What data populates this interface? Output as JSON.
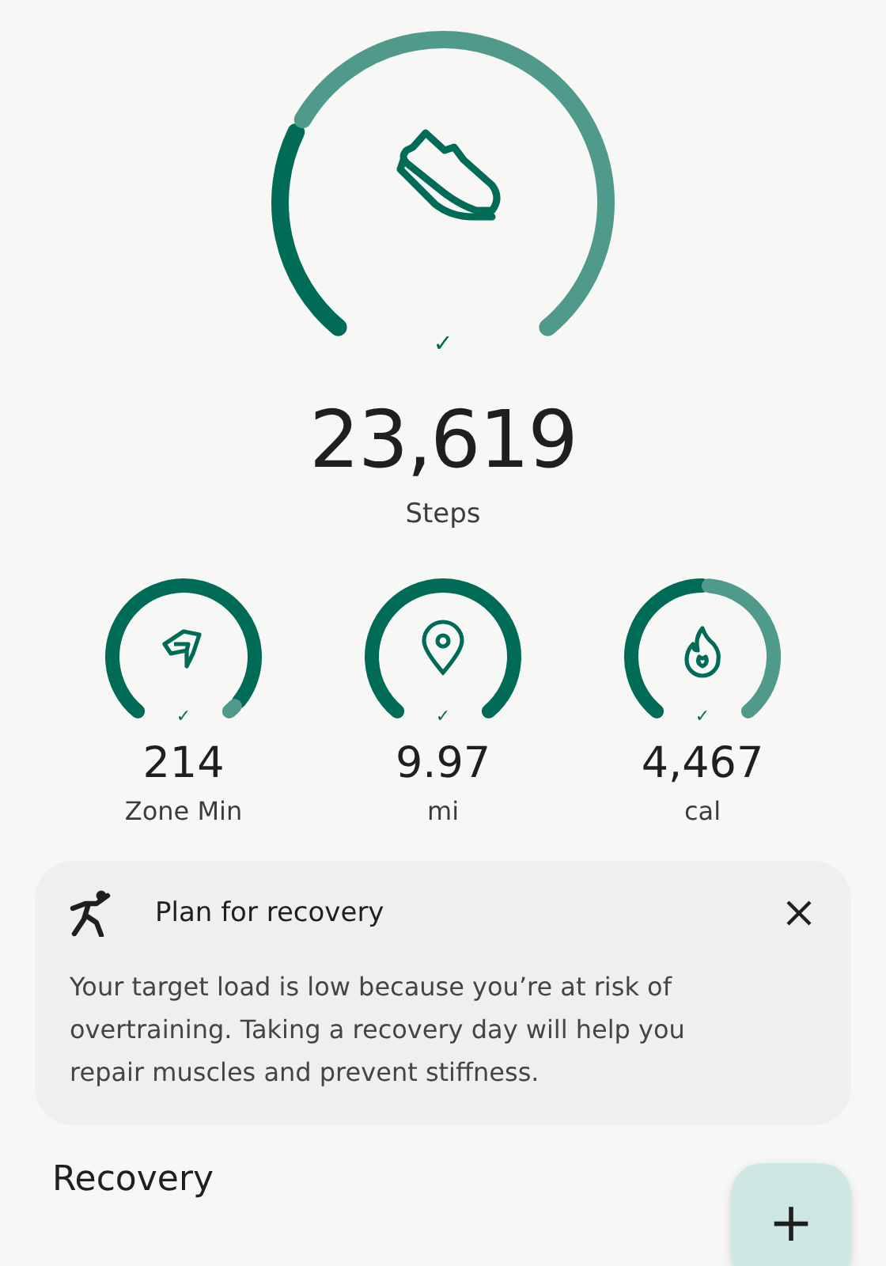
{
  "steps": {
    "check": "✓",
    "value": "23,619",
    "label": "Steps"
  },
  "metrics": [
    {
      "kind": "zone",
      "value": "214",
      "label": "Zone Min"
    },
    {
      "kind": "distance",
      "value": "9.97",
      "label": "mi"
    },
    {
      "kind": "calories",
      "value": "4,467",
      "label": "cal"
    }
  ],
  "card": {
    "title": "Plan for recovery",
    "body": "Your target load is low because you’re at risk of overtraining. Taking a recovery day will help you repair muscles and prevent stiffness."
  },
  "section_title": "Recovery",
  "fab": "+"
}
